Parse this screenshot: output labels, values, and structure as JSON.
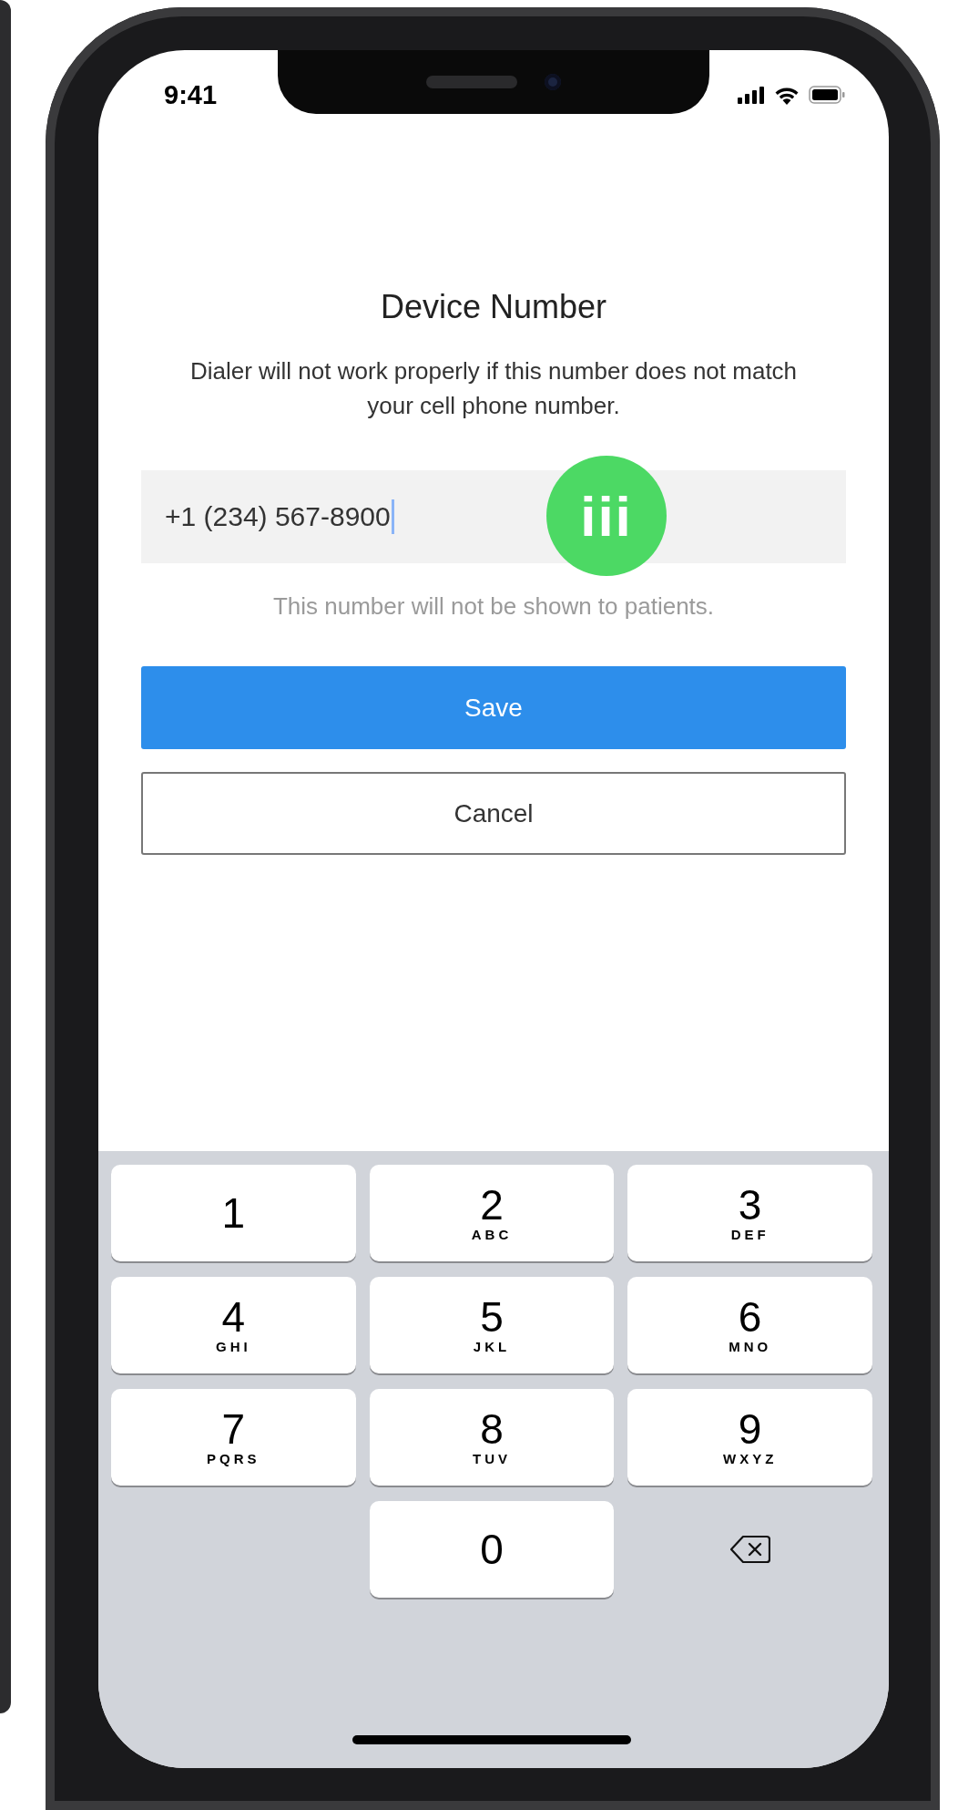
{
  "status_bar": {
    "time": "9:41"
  },
  "title": "Device Number",
  "description": "Dialer will not work properly if this number does not match your cell phone number.",
  "phone_field": {
    "value": "+1 (234) 567-8900",
    "focused": true
  },
  "annotation_badge": "iii",
  "hint": "This number will not be shown to patients.",
  "buttons": [
    {
      "label": "Save",
      "kind": "primary"
    },
    {
      "label": "Cancel",
      "kind": "secondary"
    }
  ],
  "keypad": [
    {
      "kind": "digit",
      "digit": "1"
    },
    {
      "kind": "digit",
      "digit": "2",
      "letters": "ABC"
    },
    {
      "kind": "digit",
      "digit": "3",
      "letters": "DEF"
    },
    {
      "kind": "digit",
      "digit": "4",
      "letters": "GHI"
    },
    {
      "kind": "digit",
      "digit": "5",
      "letters": "JKL"
    },
    {
      "kind": "digit",
      "digit": "6",
      "letters": "MNO"
    },
    {
      "kind": "digit",
      "digit": "7",
      "letters": "PQRS"
    },
    {
      "kind": "digit",
      "digit": "8",
      "letters": "TUV"
    },
    {
      "kind": "digit",
      "digit": "9",
      "letters": "WXYZ"
    },
    {
      "kind": "blank"
    },
    {
      "kind": "digit",
      "digit": "0"
    },
    {
      "kind": "delete"
    }
  ]
}
